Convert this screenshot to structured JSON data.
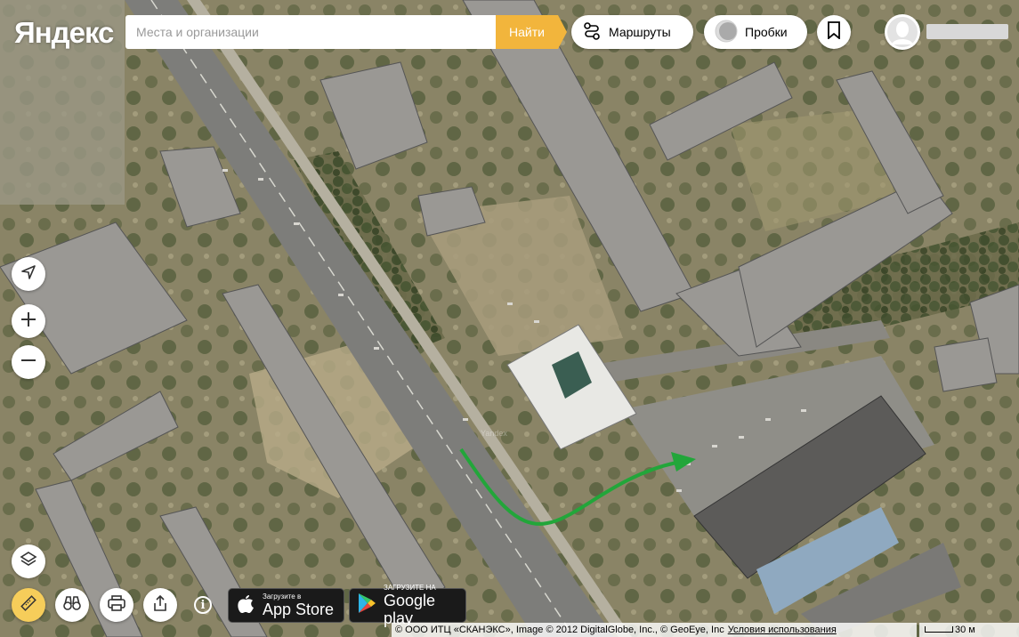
{
  "header": {
    "logo_text": "Яндекс",
    "search_placeholder": "Места и организации",
    "search_button": "Найти",
    "routes_label": "Маршруты",
    "traffic_label": "Пробки"
  },
  "bottom": {
    "app_store_small": "Загрузите в",
    "app_store_big": "App Store",
    "google_play_small": "ЗАГРУЗИТЕ НА",
    "google_play_big": "Google play",
    "info_label": "i"
  },
  "footer": {
    "copyright": "© ООО ИТЦ «СКАНЭКС», Image © 2012 DigitalGlobe, Inc., © GeoEye, Inc",
    "terms_link": "Условия использования",
    "scale_label": "30 м"
  },
  "map": {
    "watermark": "Yandex",
    "route_color": "#22a63a"
  },
  "icons": {
    "locate": "location-arrow-icon",
    "zoom_in": "plus-icon",
    "zoom_out": "minus-icon",
    "layers": "layers-icon",
    "ruler": "ruler-icon",
    "panorama": "binoculars-icon",
    "print": "printer-icon",
    "share": "share-icon",
    "bookmark": "bookmark-icon",
    "routes": "route-icon",
    "traffic": "traffic-icon"
  }
}
